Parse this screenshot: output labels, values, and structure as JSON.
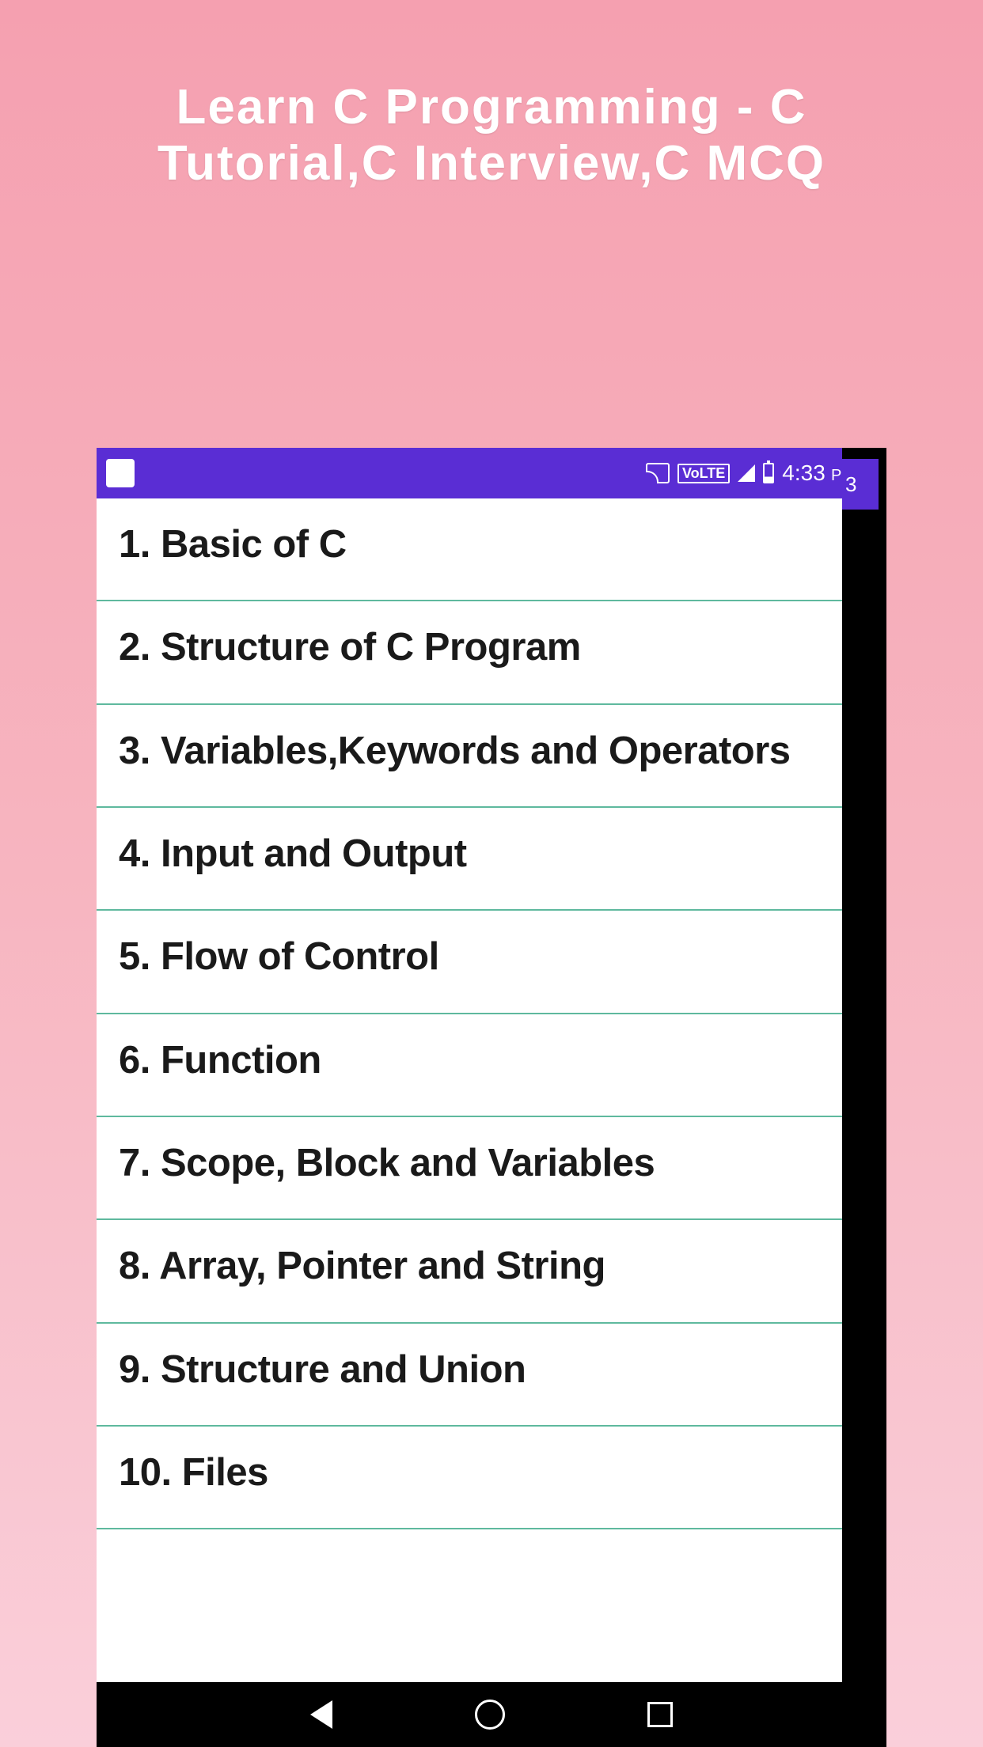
{
  "header": {
    "title": "Learn C Programming - C Tutorial,C Interview,C MCQ"
  },
  "status_bar": {
    "volte_label": "VoLTE",
    "time": "4:33",
    "time_suffix": "PM",
    "edge_time": "3"
  },
  "topics": [
    {
      "label": "1. Basic of C"
    },
    {
      "label": "2. Structure of C Program"
    },
    {
      "label": "3. Variables,Keywords and Operators"
    },
    {
      "label": "4. Input and Output"
    },
    {
      "label": "5. Flow of Control"
    },
    {
      "label": "6. Function"
    },
    {
      "label": "7. Scope, Block and Variables"
    },
    {
      "label": "8. Array, Pointer and String"
    },
    {
      "label": "9. Structure and Union"
    },
    {
      "label": "10. Files"
    }
  ]
}
